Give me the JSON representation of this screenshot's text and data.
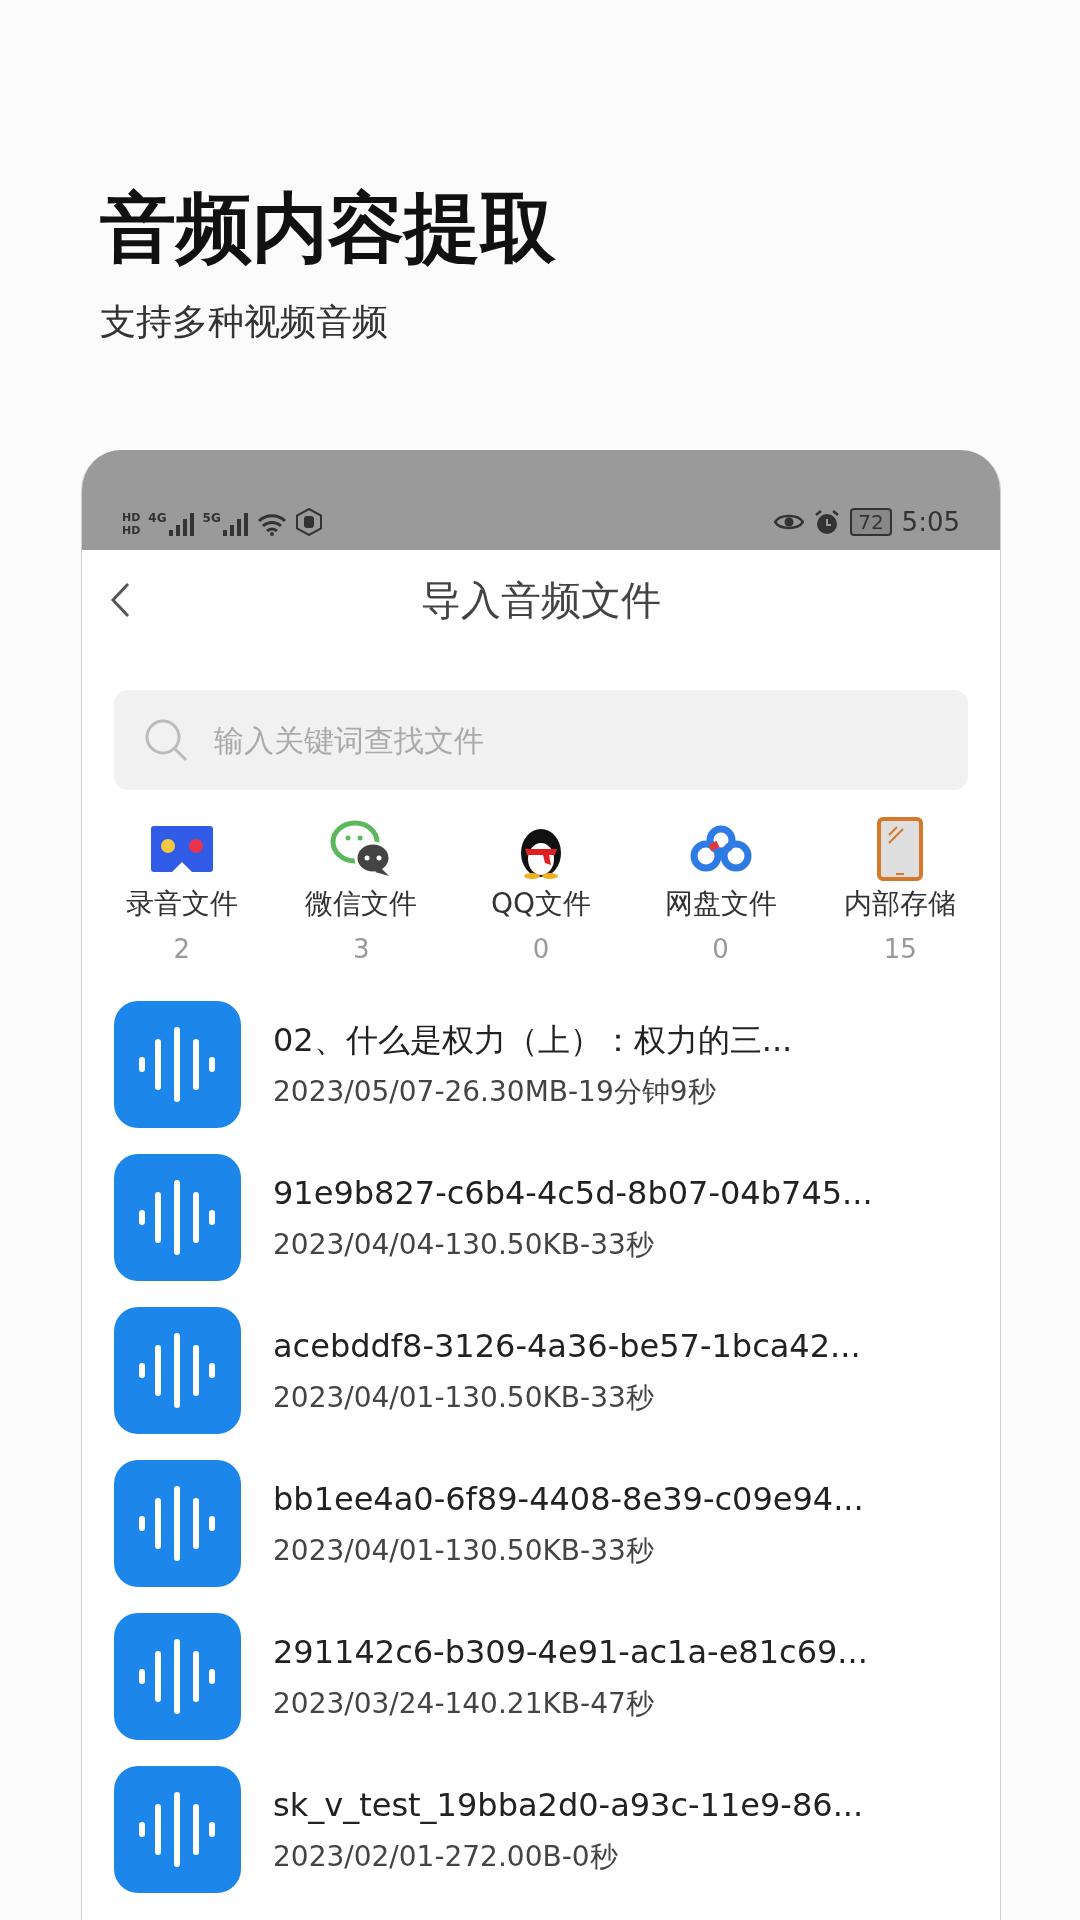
{
  "headline": {
    "title": "音频内容提取",
    "subtitle": "支持多种视频音频"
  },
  "status_bar": {
    "sim_labels": [
      "HD",
      "HD"
    ],
    "networks": [
      "4G",
      "5G"
    ],
    "battery": "72",
    "time": "5:05"
  },
  "header": {
    "title": "导入音频文件"
  },
  "search": {
    "placeholder": "输入关键词查找文件"
  },
  "categories": [
    {
      "kind": "recorder",
      "label": "录音文件",
      "count": "2"
    },
    {
      "kind": "chat",
      "label": "微信文件",
      "count": "3"
    },
    {
      "kind": "penguin",
      "label": "QQ文件",
      "count": "0"
    },
    {
      "kind": "cloud",
      "label": "网盘文件",
      "count": "0"
    },
    {
      "kind": "tablet",
      "label": "内部存储",
      "count": "15"
    }
  ],
  "files": [
    {
      "name": "02、什么是权力（上）：权力的三...",
      "meta": "2023/05/07-26.30MB-19分钟9秒"
    },
    {
      "name": "91e9b827-c6b4-4c5d-8b07-04b745...",
      "meta": "2023/04/04-130.50KB-33秒"
    },
    {
      "name": "acebddf8-3126-4a36-be57-1bca42...",
      "meta": "2023/04/01-130.50KB-33秒"
    },
    {
      "name": "bb1ee4a0-6f89-4408-8e39-c09e94...",
      "meta": "2023/04/01-130.50KB-33秒"
    },
    {
      "name": "291142c6-b309-4e91-ac1a-e81c69...",
      "meta": "2023/03/24-140.21KB-47秒"
    },
    {
      "name": "sk_v_test_19bba2d0-a93c-11e9-86...",
      "meta": "2023/02/01-272.00B-0秒"
    }
  ]
}
